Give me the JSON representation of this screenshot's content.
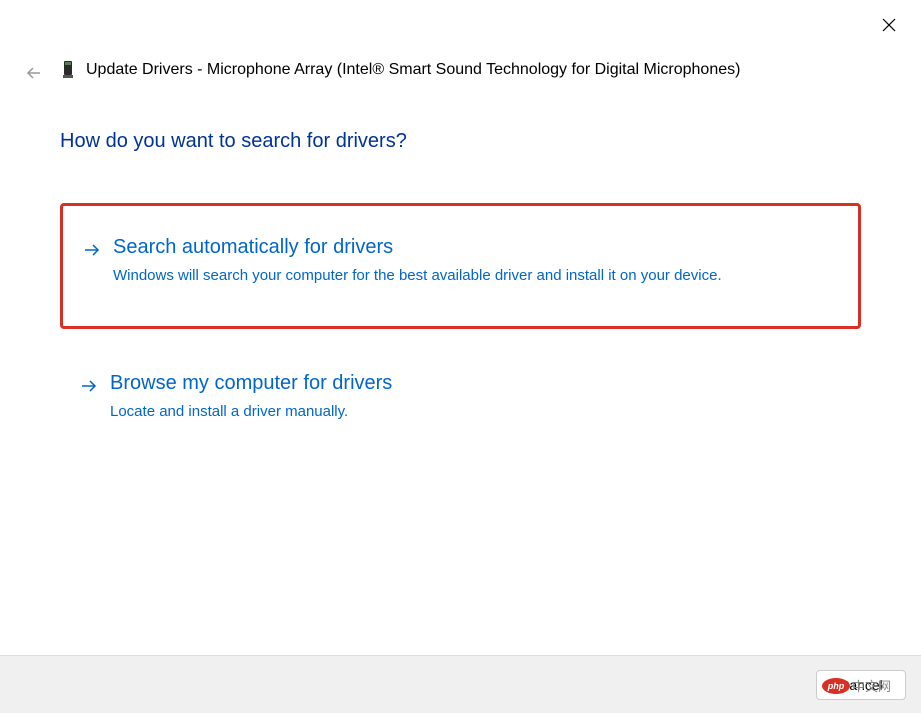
{
  "header": {
    "title": "Update Drivers - Microphone Array (Intel® Smart Sound Technology for Digital Microphones)"
  },
  "question": "How do you want to search for drivers?",
  "options": [
    {
      "title": "Search automatically for drivers",
      "description": "Windows will search your computer for the best available driver and install it on your device."
    },
    {
      "title": "Browse my computer for drivers",
      "description": "Locate and install a driver manually."
    }
  ],
  "footer": {
    "cancel_label": "Cancel"
  },
  "watermark": {
    "logo_text": "php",
    "text": "中文网"
  }
}
